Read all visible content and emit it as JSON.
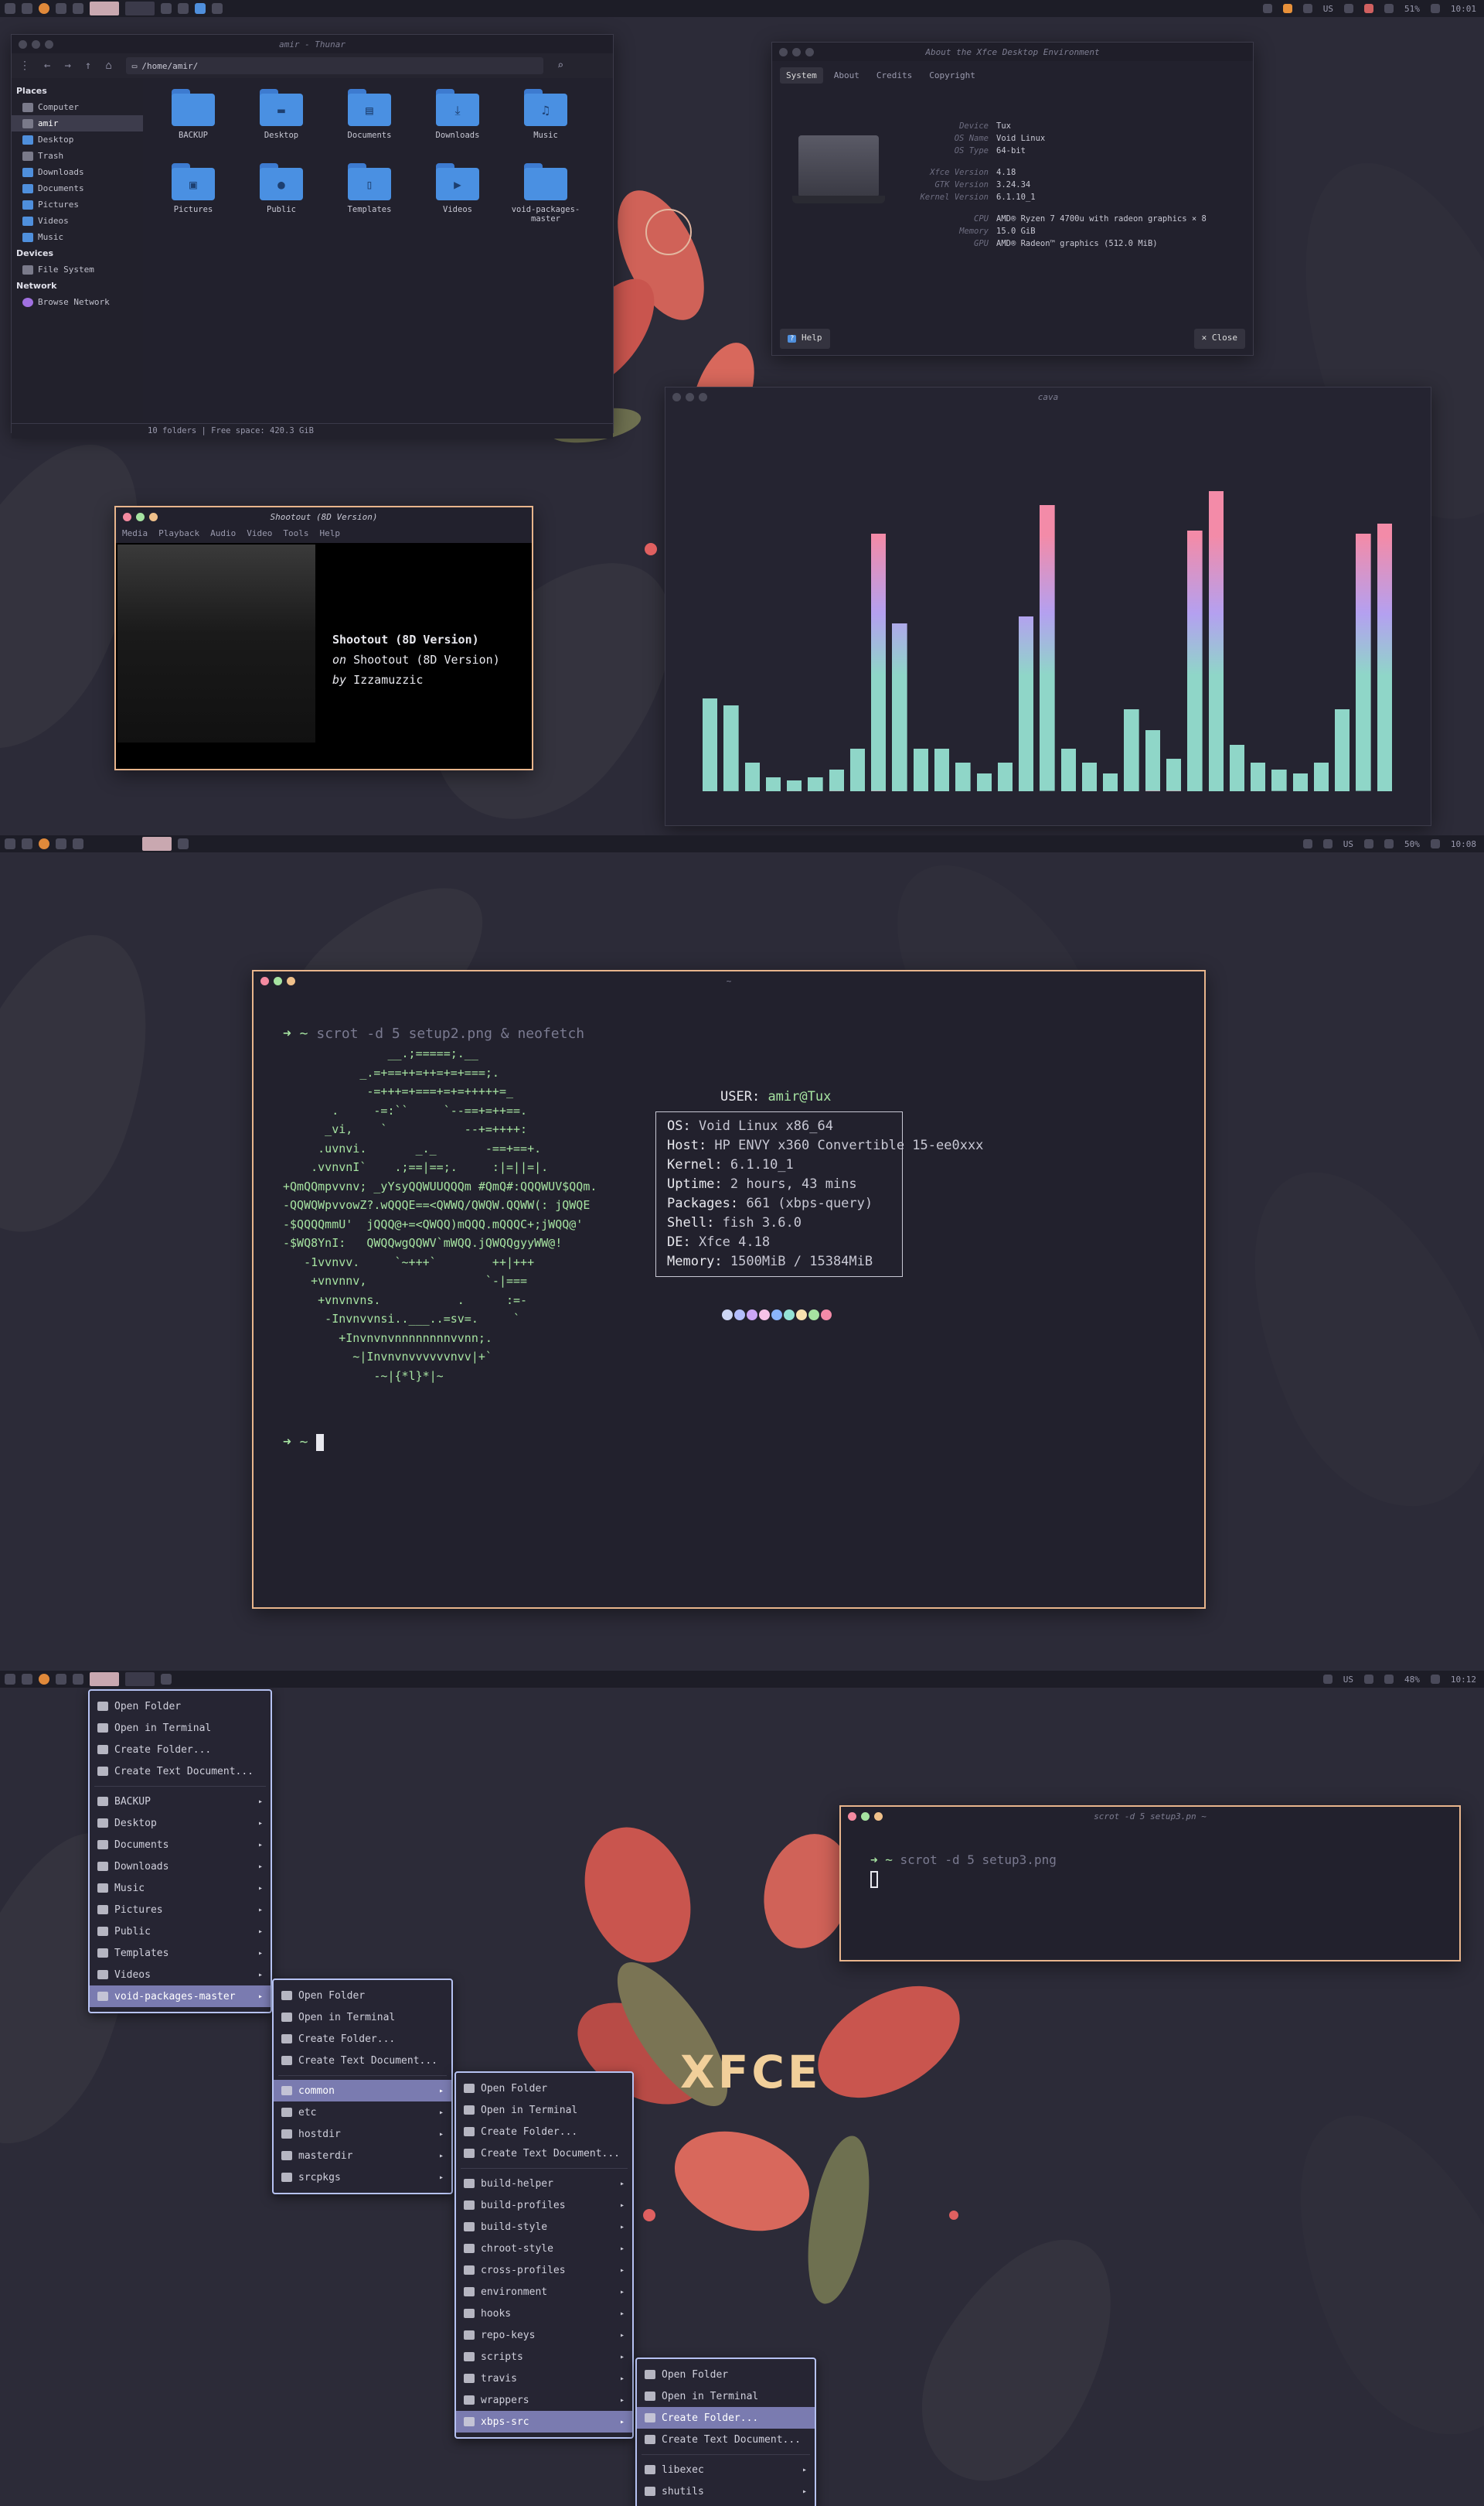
{
  "screen1": {
    "panel": {
      "right": [
        "US",
        "51%",
        "10:01"
      ]
    },
    "thunar": {
      "title": "amir - Thunar",
      "path": "/home/amir/",
      "places_header": "Places",
      "places": [
        "Computer",
        "amir",
        "Desktop",
        "Trash",
        "Downloads",
        "Documents",
        "Pictures",
        "Videos",
        "Music"
      ],
      "devices_header": "Devices",
      "devices": [
        "File System"
      ],
      "network_header": "Network",
      "network": [
        "Browse Network"
      ],
      "files": [
        "BACKUP",
        "Desktop",
        "Documents",
        "Downloads",
        "Music",
        "Pictures",
        "Public",
        "Templates",
        "Videos",
        "void-packages-master"
      ],
      "status": "10 folders  |  Free space: 420.3 GiB"
    },
    "about": {
      "title": "About the Xfce Desktop Environment",
      "tabs": [
        "System",
        "About",
        "Credits",
        "Copyright"
      ],
      "info": [
        [
          "Device",
          "Tux"
        ],
        [
          "OS Name",
          "Void Linux"
        ],
        [
          "OS Type",
          "64-bit"
        ],
        [
          "",
          ""
        ],
        [
          "Xfce Version",
          "4.18"
        ],
        [
          "GTK Version",
          "3.24.34"
        ],
        [
          "Kernel Version",
          "6.1.10_1"
        ],
        [
          "",
          ""
        ],
        [
          "CPU",
          "AMD® Ryzen 7 4700u with radeon graphics × 8"
        ],
        [
          "Memory",
          "15.0 GiB"
        ],
        [
          "GPU",
          "AMD® Radeon™ graphics (512.0 MiB)"
        ]
      ],
      "help": "Help",
      "close": "Close"
    },
    "player": {
      "title": "Shootout (8D Version)",
      "menu": [
        "Media",
        "Playback",
        "Audio",
        "Video",
        "Tools",
        "Help"
      ],
      "track": "Shootout (8D Version)",
      "on_prefix": "on",
      "album": "Shootout (8D Version)",
      "by_prefix": "by",
      "artist": "Izzamuzzic"
    },
    "cava": {
      "title": "cava",
      "bars": [
        0.26,
        0.24,
        0.08,
        0.04,
        0.03,
        0.04,
        0.06,
        0.12,
        0.72,
        0.47,
        0.12,
        0.12,
        0.08,
        0.05,
        0.08,
        0.49,
        0.8,
        0.12,
        0.08,
        0.05,
        0.23,
        0.17,
        0.09,
        0.73,
        0.84,
        0.13,
        0.08,
        0.06,
        0.05,
        0.08,
        0.23,
        0.72,
        0.75
      ]
    }
  },
  "screen2": {
    "panel": {
      "right": [
        "US",
        "50%",
        "10:08"
      ]
    },
    "terminal": {
      "title": "~",
      "command": "scrot -d 5 setup2.png & neofetch",
      "prompt": "➜ ~",
      "ascii": [
        "               __.;=====;.__",
        "           _.=+==++=++=+=+===;.",
        "            -=+++=+===+=+=+++++=_",
        "       .     -=:``     `--==+=++==.",
        "      _vi,    `           --+=++++:",
        "     .uvnvi.       _._       -==+==+.",
        "    .vvnvnI`    .;==|==;.     :|=||=|.",
        "+QmQQmpvvnv; _yYsyQQWUUQQQm #QmQ#:QQQWUV$QQm.",
        "-QQWQWpvvowZ?.wQQQE==<QWWQ/QWQW.QQWW(: jQWQE",
        "-$QQQQmmU'  jQQQ@+=<QWQQ)mQQQ.mQQQC+;jWQQ@'",
        "-$WQ8YnI:   QWQQwgQQWV`mWQQ.jQWQQgyyWW@!",
        "   -1vvnvv.     `~+++`        ++|+++",
        "    +vnvnnv,                 `-|===",
        "     +vnvnvns.           .      :=-",
        "      -Invnvvnsi..___..=sv=.     `",
        "        +Invnvnvnnnnnnnnvvnn;.",
        "          ~|Invnvnvvvvvvnvv|+`",
        "             -~|{*l}*|~"
      ],
      "user": "USER:",
      "user_val": "amir@Tux",
      "info": [
        [
          "OS:",
          "Void Linux x86_64"
        ],
        [
          "Host:",
          "HP ENVY x360 Convertible 15-ee0xxx"
        ],
        [
          "Kernel:",
          "6.1.10_1"
        ],
        [
          "Uptime:",
          "2 hours, 43 mins"
        ],
        [
          "Packages:",
          "661 (xbps-query)"
        ],
        [
          "Shell:",
          "fish 3.6.0"
        ],
        [
          "DE:",
          "Xfce 4.18"
        ],
        [
          "Memory:",
          "1500MiB / 15384MiB"
        ]
      ],
      "palette": [
        "#cdd6f4",
        "#b4befe",
        "#cba6f7",
        "#f5c2e7",
        "#89b4fa",
        "#94e2d5",
        "#f9e2af",
        "#a6e3a1",
        "#f38ba8"
      ]
    }
  },
  "screen3": {
    "panel": {
      "right": [
        "US",
        "48%",
        "10:12"
      ]
    },
    "terminal": {
      "title": "scrot -d 5 setup3.pn ~",
      "prompt": "➜ ~",
      "command": "scrot -d 5 setup3.png"
    },
    "logo": "XFCE",
    "menu1": {
      "actions": [
        "Open Folder",
        "Open in Terminal",
        "Create Folder...",
        "Create Text Document..."
      ],
      "items": [
        "BACKUP",
        "Desktop",
        "Documents",
        "Downloads",
        "Music",
        "Pictures",
        "Public",
        "Templates",
        "Videos",
        "void-packages-master"
      ]
    },
    "menu2": {
      "actions": [
        "Open Folder",
        "Open in Terminal",
        "Create Folder...",
        "Create Text Document..."
      ],
      "items": [
        "common",
        "etc",
        "hostdir",
        "masterdir",
        "srcpkgs"
      ]
    },
    "menu3": {
      "actions": [
        "Open Folder",
        "Open in Terminal",
        "Create Folder...",
        "Create Text Document..."
      ],
      "items": [
        "build-helper",
        "build-profiles",
        "build-style",
        "chroot-style",
        "cross-profiles",
        "environment",
        "hooks",
        "repo-keys",
        "scripts",
        "travis",
        "wrappers",
        "xbps-src"
      ]
    },
    "menu4": {
      "actions": [
        "Open Folder",
        "Open in Terminal",
        "Create Folder...",
        "Create Text Document..."
      ],
      "items": [
        "libexec",
        "shutils"
      ]
    }
  },
  "colors": {
    "accent": "#e8b58c",
    "menu_border": "#b6c2f2",
    "bg": "#2c2b38",
    "cava_top": "#f38ba8",
    "cava_mid": "#b4a0f0",
    "cava_low": "#8fd6c8"
  }
}
